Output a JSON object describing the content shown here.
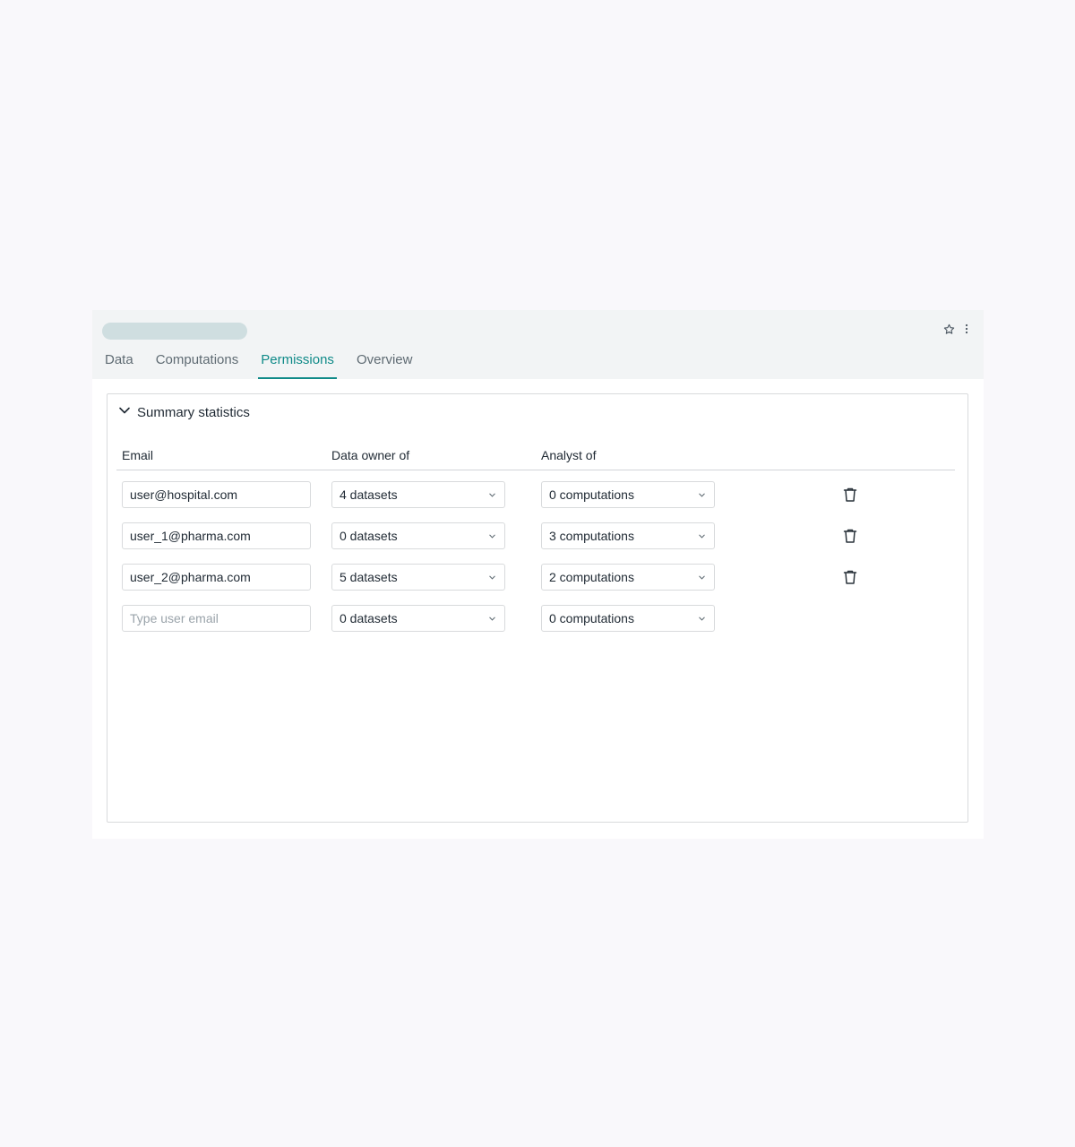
{
  "header": {
    "star_icon": "star-icon",
    "more_icon": "more-vertical-icon"
  },
  "tabs": [
    {
      "label": "Data",
      "active": false
    },
    {
      "label": "Computations",
      "active": false
    },
    {
      "label": "Permissions",
      "active": true
    },
    {
      "label": "Overview",
      "active": false
    }
  ],
  "colors": {
    "accent": "#0f8a88",
    "header_bg": "#f2f4f5",
    "page_bg": "#f9f8fb"
  },
  "panel": {
    "title": "Summary statistics",
    "expanded": true,
    "columns": {
      "email": "Email",
      "owner": "Data owner of",
      "analyst": "Analyst of"
    },
    "rows": [
      {
        "email": "user@hospital.com",
        "owner": "4 datasets",
        "analyst": "0 computations",
        "deletable": true
      },
      {
        "email": "user_1@pharma.com",
        "owner": "0 datasets",
        "analyst": "3 computations",
        "deletable": true
      },
      {
        "email": "user_2@pharma.com",
        "owner": "5 datasets",
        "analyst": "2 computations",
        "deletable": true
      }
    ],
    "new_row": {
      "email_placeholder": "Type user email",
      "owner": "0 datasets",
      "analyst": "0 computations"
    }
  }
}
